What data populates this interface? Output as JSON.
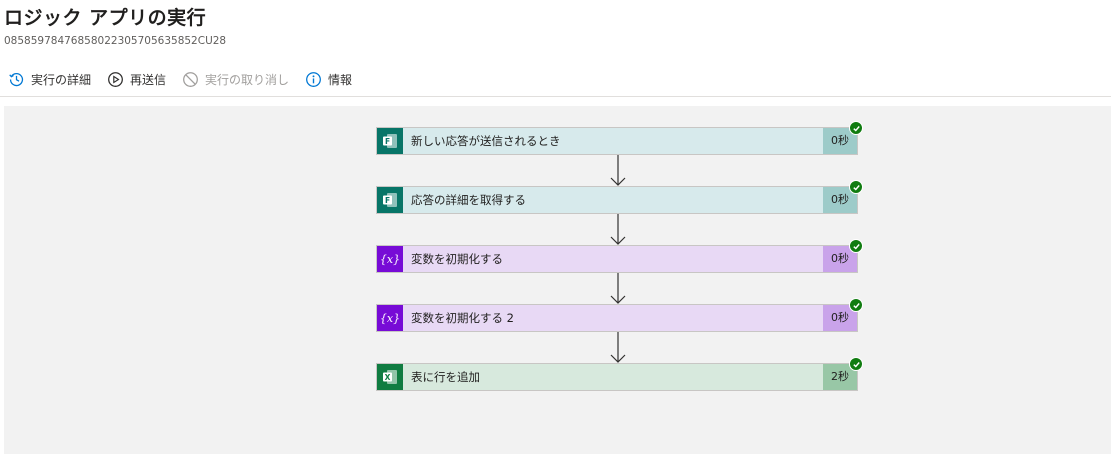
{
  "header": {
    "title": "ロジック アプリの実行",
    "run_id": "08585978476858022305705635852CU28"
  },
  "toolbar": {
    "items": [
      {
        "label": "実行の詳細",
        "icon": "history-icon",
        "enabled": true
      },
      {
        "label": "再送信",
        "icon": "resubmit-icon",
        "enabled": true
      },
      {
        "label": "実行の取り消し",
        "icon": "cancel-icon",
        "enabled": false
      },
      {
        "label": "情報",
        "icon": "info-icon",
        "enabled": true
      }
    ]
  },
  "workflow": {
    "steps": [
      {
        "label": "新しい応答が送信されるとき",
        "duration": "0秒",
        "connector": "Microsoft Forms",
        "icon": "forms-icon",
        "status": "succeeded"
      },
      {
        "label": "応答の詳細を取得する",
        "duration": "0秒",
        "connector": "Microsoft Forms",
        "icon": "forms-icon",
        "status": "succeeded"
      },
      {
        "label": "変数を初期化する",
        "duration": "0秒",
        "connector": "Variables",
        "icon": "variable-icon",
        "status": "succeeded"
      },
      {
        "label": "変数を初期化する 2",
        "duration": "0秒",
        "connector": "Variables",
        "icon": "variable-icon",
        "status": "succeeded"
      },
      {
        "label": "表に行を追加",
        "duration": "2秒",
        "connector": "Excel",
        "icon": "excel-icon",
        "status": "succeeded"
      }
    ]
  },
  "colors": {
    "forms": "#077568",
    "variables": "#770bd6",
    "excel": "#107c41",
    "success": "#107c10",
    "accent": "#0078d4"
  }
}
